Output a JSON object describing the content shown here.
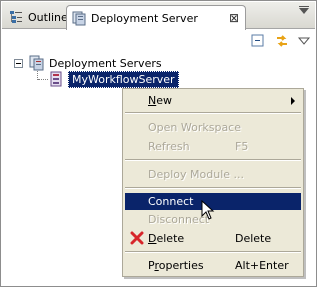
{
  "tabs": [
    {
      "label": "Outline",
      "icon": "outline-icon",
      "active": false
    },
    {
      "label": "Deployment Server",
      "icon": "deployment-server-icon",
      "active": true,
      "close_glyph": "⊠"
    }
  ],
  "toolbar": {
    "collapse_all_icon": "collapse-all-icon",
    "link_editor_icon": "link-with-editor-icon",
    "view_menu_icon": "view-menu-icon"
  },
  "tree": {
    "root": {
      "label": "Deployment Servers",
      "expanded": true
    },
    "child": {
      "label": "MyWorkflowServer",
      "selected": true
    }
  },
  "context_menu": {
    "items": [
      {
        "label_underlined": "N",
        "label_rest": "ew",
        "accel": "",
        "enabled": true,
        "submenu": true
      },
      {
        "label": "Open Workspace",
        "accel": "",
        "enabled": false
      },
      {
        "label": "Refresh",
        "accel": "F5",
        "enabled": false
      },
      {
        "label": "Deploy Module ...",
        "accel": "",
        "enabled": false
      },
      {
        "label": "Connect",
        "accel": "",
        "enabled": true,
        "highlighted": true
      },
      {
        "label": "Disconnect",
        "accel": "",
        "enabled": false
      },
      {
        "label_underlined": "D",
        "label_rest": "elete",
        "accel": "Delete",
        "enabled": true,
        "icon": "delete-x-icon"
      },
      {
        "label_prefix": "P",
        "label_underlined": "r",
        "label_rest": "operties",
        "accel": "Alt+Enter",
        "enabled": true
      }
    ]
  },
  "colors": {
    "selection": "#0a246a",
    "menu_bg": "#ece9d8",
    "disabled_text": "#aca899",
    "delete_icon": "#d7262b"
  }
}
